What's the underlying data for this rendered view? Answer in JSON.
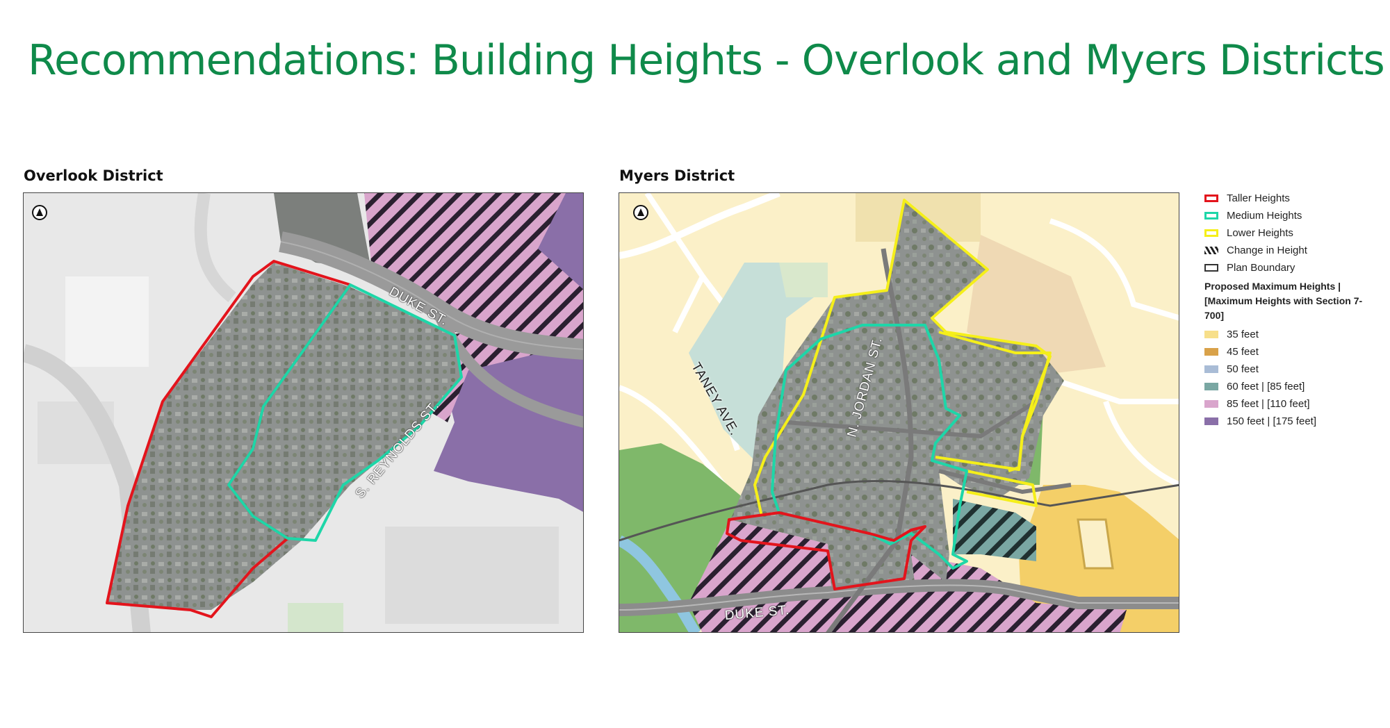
{
  "title": "Recommendations: Building Heights - Overlook and Myers Districts",
  "maps": {
    "overlook": {
      "heading": "Overlook District",
      "streets": [
        "DUKE ST.",
        "S. REYNOLDS ST."
      ]
    },
    "myers": {
      "heading": "Myers District",
      "streets": [
        "TANEY AVE.",
        "N. JORDAN ST.",
        "DUKE ST."
      ]
    }
  },
  "north_arrow_icon": "north-arrow-icon",
  "legend": {
    "outline_items": [
      {
        "label": "Taller Heights",
        "color": "#e3141c"
      },
      {
        "label": "Medium Heights",
        "color": "#1ed6a8"
      },
      {
        "label": "Lower Heights",
        "color": "#f5ef1a"
      },
      {
        "label": "Change in Height",
        "color": "#222222",
        "icon": "diagonal-hatch-icon"
      },
      {
        "label": "Plan Boundary",
        "color": "#333333"
      }
    ],
    "heights_heading": "Proposed Maximum Heights | [Maximum Heights with Section 7-700]",
    "height_items": [
      {
        "label": "35 feet",
        "color": "#f7df8a"
      },
      {
        "label": "45 feet",
        "color": "#d9a24a"
      },
      {
        "label": "50 feet",
        "color": "#a9bcd6"
      },
      {
        "label": "60 feet | [85 feet]",
        "color": "#7aa7a3"
      },
      {
        "label": "85 feet | [110 feet]",
        "color": "#d9a5cc"
      },
      {
        "label": "150 feet | [175 feet]",
        "color": "#8a6fa8"
      }
    ]
  }
}
